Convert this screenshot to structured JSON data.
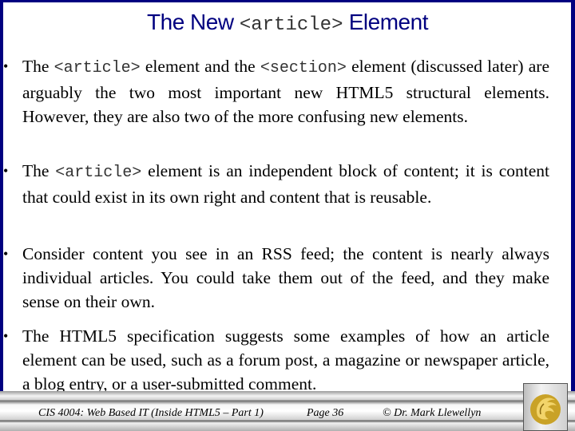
{
  "slide": {
    "title": {
      "prefix": "The New",
      "code": "<article>",
      "suffix": "Element"
    },
    "bullets": [
      {
        "parts": [
          {
            "t": "The "
          },
          {
            "code": "<article>"
          },
          {
            "t": " element and the "
          },
          {
            "code": "<section>"
          },
          {
            "t": " element (discussed later) are arguably the two most important new HTML5 structural elements.  However, they are also two of the more confusing new elements."
          }
        ]
      },
      {
        "parts": [
          {
            "t": "The "
          },
          {
            "code": "<article>"
          },
          {
            "t": " element is an independent block of content;  it is content that could exist in its own right and content that is reusable."
          }
        ]
      },
      {
        "parts": [
          {
            "t": "Consider content you see in an RSS feed; the content is nearly always individual articles.  You could take them out of the feed, and they make sense on their own."
          }
        ]
      },
      {
        "parts": [
          {
            "t": "The HTML5 specification suggests some examples of how an article element can be used, such as a forum post, a magazine or newspaper article, a blog entry, or a user-submitted comment."
          }
        ]
      }
    ],
    "bullet_glyph": "•"
  },
  "footer": {
    "course": "CIS 4004: Web Based IT (Inside HTML5 – Part 1)",
    "page": "Page 36",
    "author": "© Dr. Mark Llewellyn",
    "logo": "ucf-pegasus-logo"
  },
  "colors": {
    "border": "#000080",
    "title": "#000080",
    "logo_gold": "#c9a227"
  }
}
